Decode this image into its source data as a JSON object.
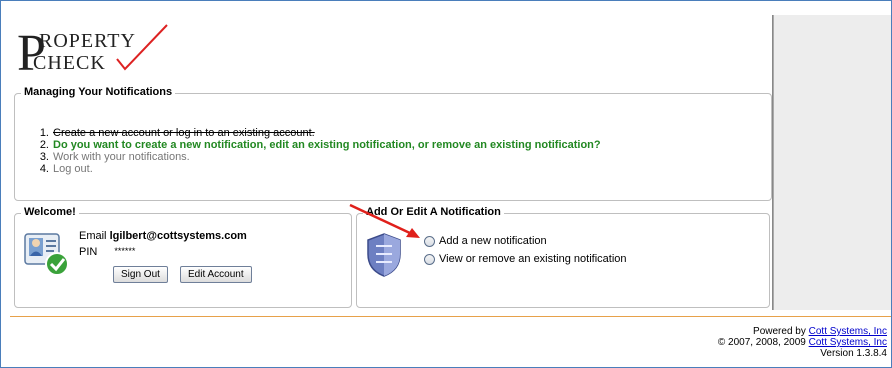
{
  "logo": {
    "letter_p": "P",
    "line1": "ROPERTY",
    "line2": "CHECK"
  },
  "notifications": {
    "title": "Managing Your Notifications",
    "steps": [
      {
        "num": "1.",
        "text": "Create a new account or log in to an existing account."
      },
      {
        "num": "2.",
        "text": "Do you want to create a new notification, edit an existing notification, or remove an existing notification?"
      },
      {
        "num": "3.",
        "text": "Work with your notifications."
      },
      {
        "num": "4.",
        "text": "Log out."
      }
    ]
  },
  "welcome": {
    "title": "Welcome!",
    "email_label": "Email",
    "email_value": "lgilbert@cottsystems.com",
    "pin_label": "PIN",
    "pin_value": "******",
    "sign_out_label": "Sign Out",
    "edit_account_label": "Edit Account",
    "user_icon": "user-card-check-icon"
  },
  "add_edit": {
    "title": "Add Or Edit A Notification",
    "shield_icon": "shield-icon",
    "options": [
      {
        "label": "Add a new notification"
      },
      {
        "label": "View or remove an existing notification"
      }
    ]
  },
  "footer": {
    "powered_by": "Powered by",
    "company": "Cott Systems, Inc",
    "copyright": "© 2007, 2008, 2009",
    "company2": "Cott Systems, Inc",
    "version": "Version 1.3.8.4"
  },
  "colors": {
    "step_current": "#228822",
    "step_pending": "#777777",
    "arrow": "#e0201b",
    "link": "#0000cc"
  }
}
